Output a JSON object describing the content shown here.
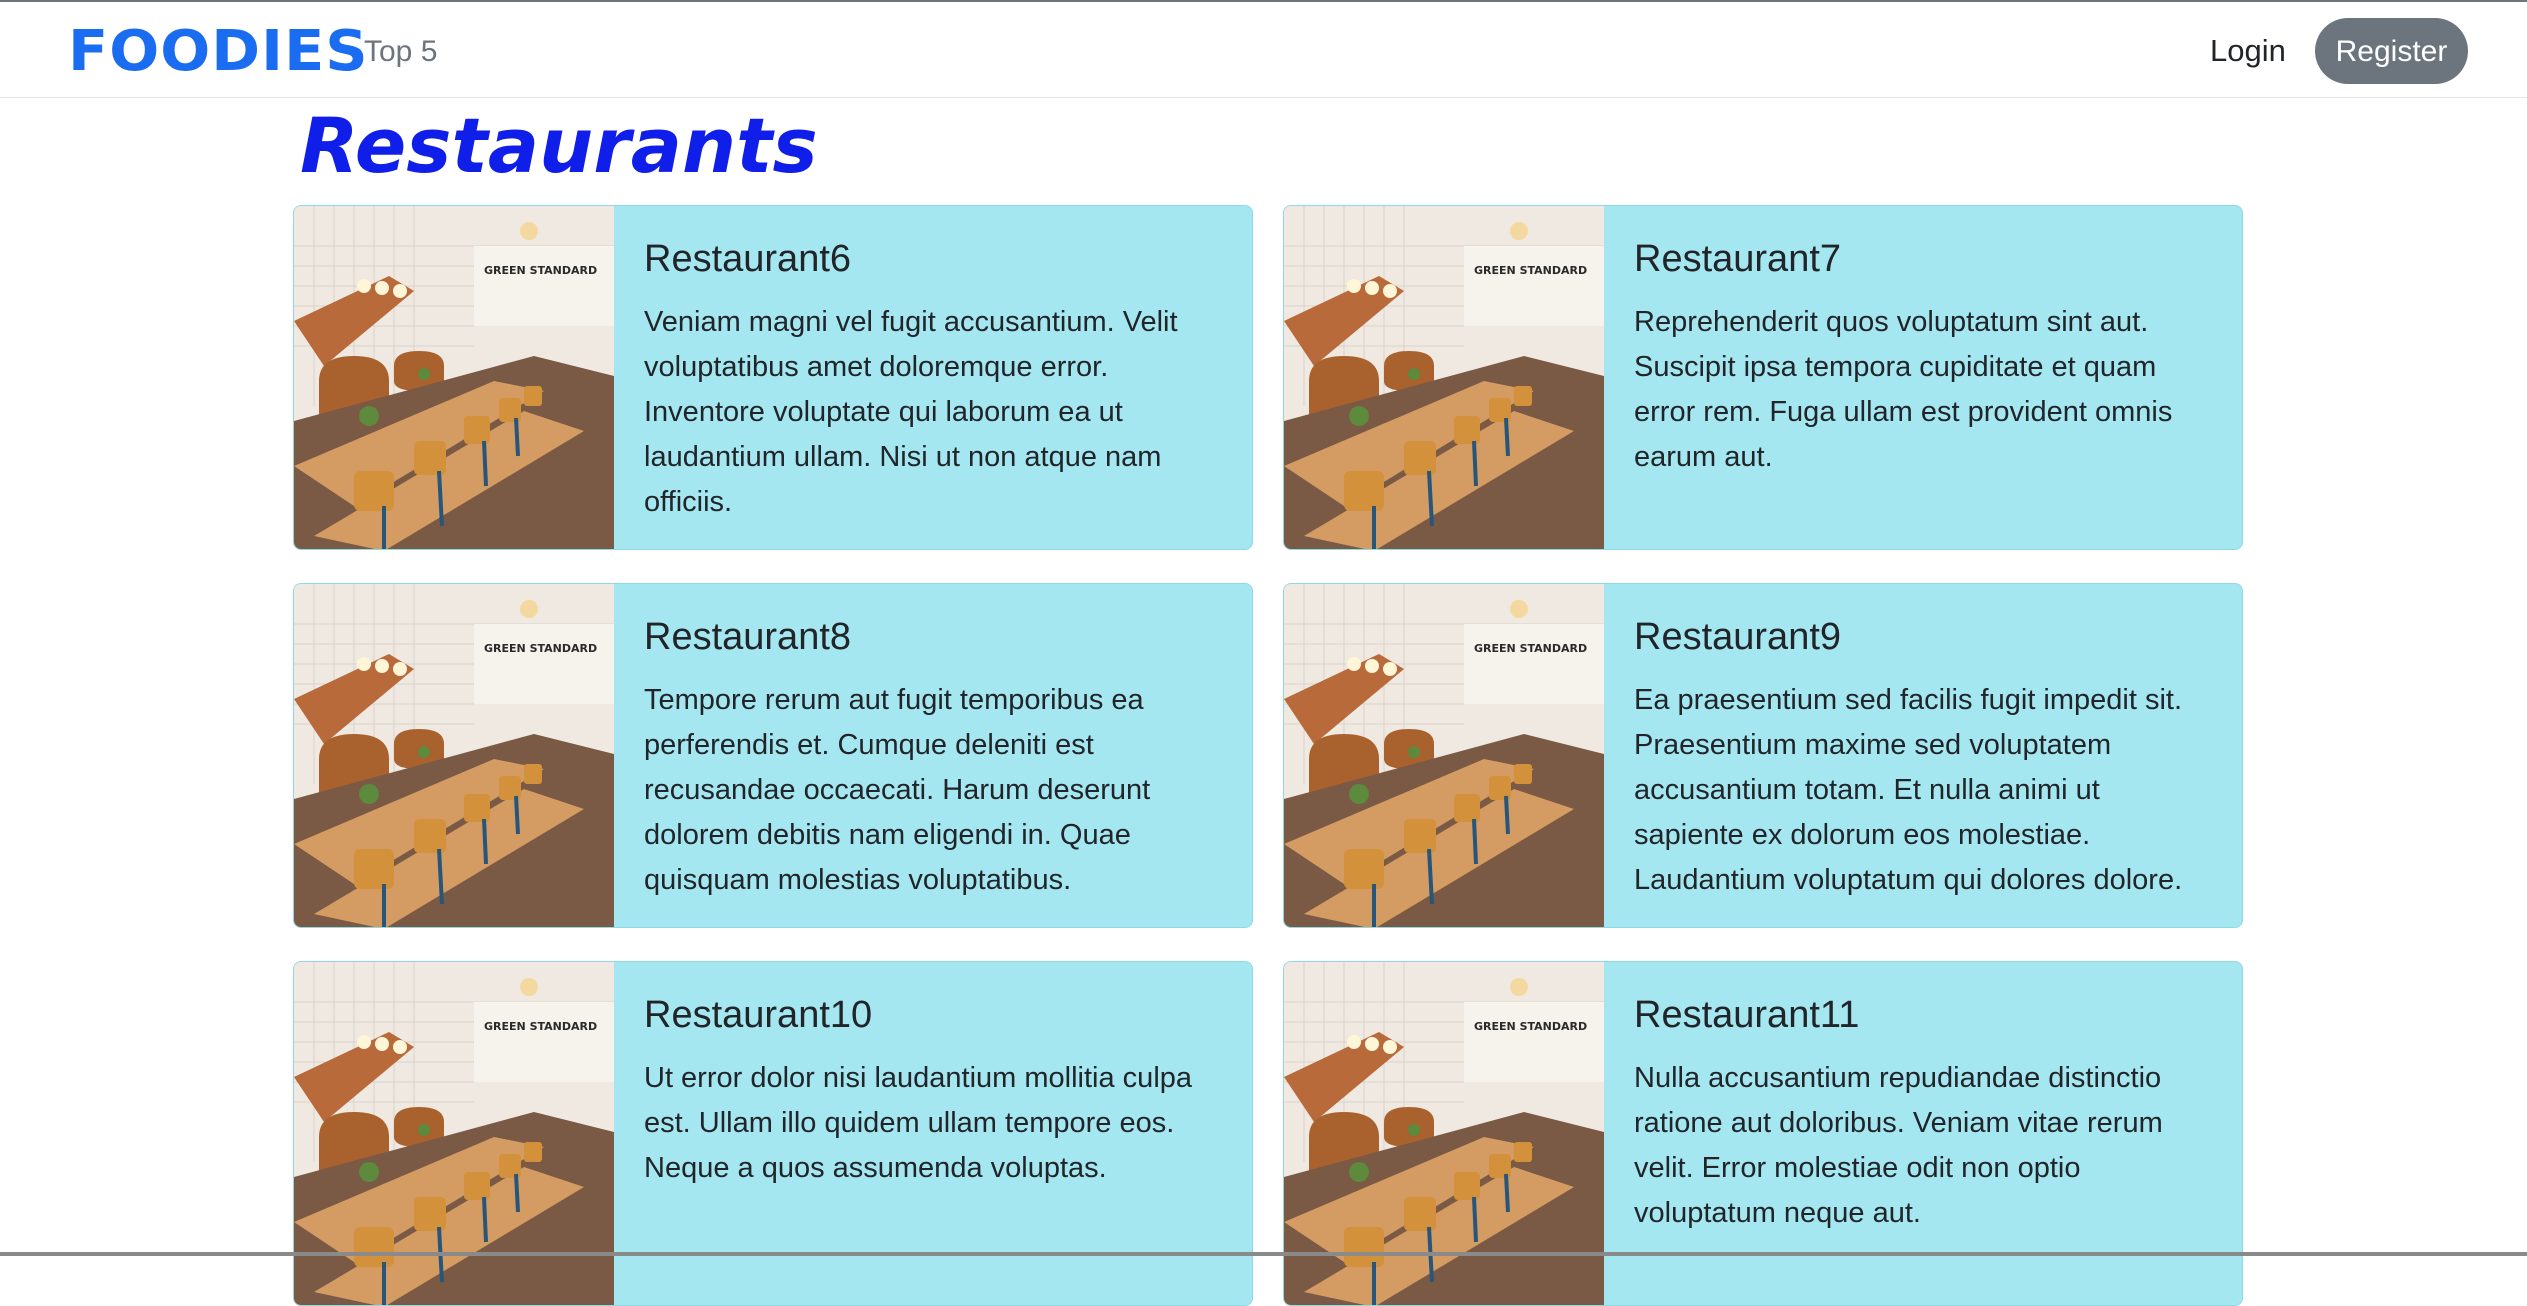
{
  "navbar": {
    "brand": "FOODIES",
    "links": [
      {
        "label": "Top 5"
      }
    ],
    "login_label": "Login",
    "register_label": "Register"
  },
  "page": {
    "heading": "Restaurants"
  },
  "image": {
    "sign_text": "GREEN STANDARD"
  },
  "restaurants": [
    {
      "name": "Restaurant6",
      "description": "Veniam magni vel fugit accusantium. Velit voluptatibus amet doloremque error. Inventore voluptate qui laborum ea ut laudantium ullam. Nisi ut non atque nam officiis."
    },
    {
      "name": "Restaurant7",
      "description": "Reprehenderit quos voluptatum sint aut. Suscipit ipsa tempora cupiditate et quam error rem. Fuga ullam est provident omnis earum aut."
    },
    {
      "name": "Restaurant8",
      "description": "Tempore rerum aut fugit temporibus ea perferendis et. Cumque deleniti est recusandae occaecati. Harum deserunt dolorem debitis nam eligendi in. Quae quisquam molestias voluptatibus."
    },
    {
      "name": "Restaurant9",
      "description": "Ea praesentium sed facilis fugit impedit sit. Praesentium maxime sed voluptatem accusantium totam. Et nulla animi ut sapiente ex dolorum eos molestiae. Laudantium voluptatum qui dolores dolore."
    },
    {
      "name": "Restaurant10",
      "description": "Ut error dolor nisi laudantium mollitia culpa est. Ullam illo quidem ullam tempore eos. Neque a quos assumenda voluptas."
    },
    {
      "name": "Restaurant11",
      "description": "Nulla accusantium repudiandae distinctio ratione aut doloribus. Veniam vitae rerum velit. Error molestiae odit non optio voluptatum neque aut."
    }
  ],
  "colors": {
    "brand": "#1a6cf0",
    "heading": "#0f1ee8",
    "card_bg": "#a5e7f1",
    "register_bg": "#6c757d"
  }
}
